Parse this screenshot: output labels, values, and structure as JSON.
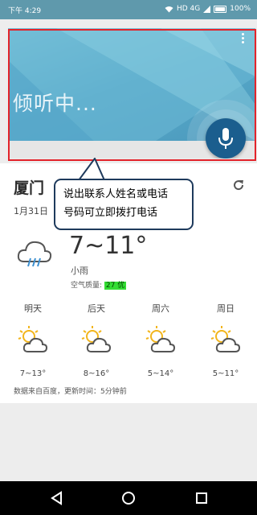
{
  "status_bar": {
    "time": "下午 4:29",
    "indicators": "HD 4G",
    "battery": "100%"
  },
  "voice_panel": {
    "listening_text": "倾听中...",
    "mic_icon": "microphone-icon",
    "menu_icon": "more-vert-icon"
  },
  "weather": {
    "city": "厦门",
    "date": "1月31日",
    "current": {
      "temperature": "7~11°",
      "condition": "小雨",
      "air_quality_label": "空气质量:",
      "air_quality_value": "27 优",
      "icon": "light-rain-icon"
    },
    "forecast": [
      {
        "day": "明天",
        "range": "7~13°",
        "icon": "partly-cloudy-icon"
      },
      {
        "day": "后天",
        "range": "8~16°",
        "icon": "partly-cloudy-icon"
      },
      {
        "day": "周六",
        "range": "5~14°",
        "icon": "partly-cloudy-icon"
      },
      {
        "day": "周日",
        "range": "5~11°",
        "icon": "partly-cloudy-icon"
      }
    ],
    "source": "数据来自百度，更新时间：5分钟前"
  },
  "annotation": {
    "line1": "说出联系人姓名或电话",
    "line2": "号码可立即拨打电话",
    "highlight_color": "#e3232a"
  },
  "colors": {
    "accent": "#1b5e8e",
    "aqi_good": "#33dd33"
  }
}
